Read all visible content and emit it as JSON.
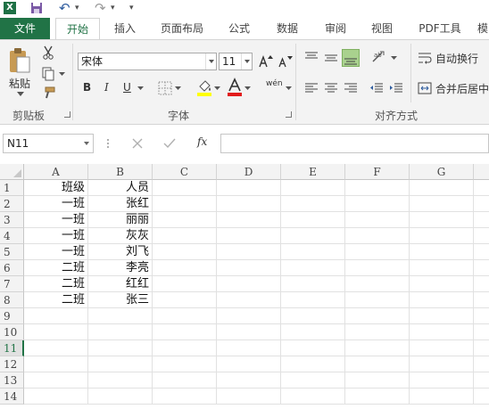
{
  "app_icon": "X",
  "qat": {
    "undo": "↶",
    "redo": "↷",
    "more": "▾"
  },
  "tabs": [
    {
      "label": "文件"
    },
    {
      "label": "开始"
    },
    {
      "label": "插入"
    },
    {
      "label": "页面布局"
    },
    {
      "label": "公式"
    },
    {
      "label": "数据"
    },
    {
      "label": "审阅"
    },
    {
      "label": "视图"
    },
    {
      "label": "PDF工具"
    },
    {
      "label": "模"
    }
  ],
  "ribbon": {
    "clipboard": {
      "paste": "粘贴",
      "group": "剪贴板"
    },
    "font": {
      "name": "宋体",
      "size": "11",
      "bold": "B",
      "italic": "I",
      "underline": "U",
      "wen": "wén",
      "group": "字体"
    },
    "align": {
      "wrap": "自动换行",
      "merge": "合并后居中",
      "group": "对齐方式"
    }
  },
  "formula_bar": {
    "name_box": "N11",
    "fx": "fx",
    "value": ""
  },
  "columns": [
    "A",
    "B",
    "C",
    "D",
    "E",
    "F",
    "G"
  ],
  "rows": [
    "1",
    "2",
    "3",
    "4",
    "5",
    "6",
    "7",
    "8",
    "9",
    "10",
    "11",
    "12",
    "13",
    "14"
  ],
  "selected_row": "11",
  "cells": [
    [
      "班级",
      "人员"
    ],
    [
      "一班",
      "张红"
    ],
    [
      "一班",
      "丽丽"
    ],
    [
      "一班",
      "灰灰"
    ],
    [
      "一班",
      "刘飞"
    ],
    [
      "二班",
      "李亮"
    ],
    [
      "二班",
      "红红"
    ],
    [
      "二班",
      "张三"
    ]
  ],
  "colors": {
    "accent": "#217346",
    "fill_highlight": "#a9d18e"
  }
}
